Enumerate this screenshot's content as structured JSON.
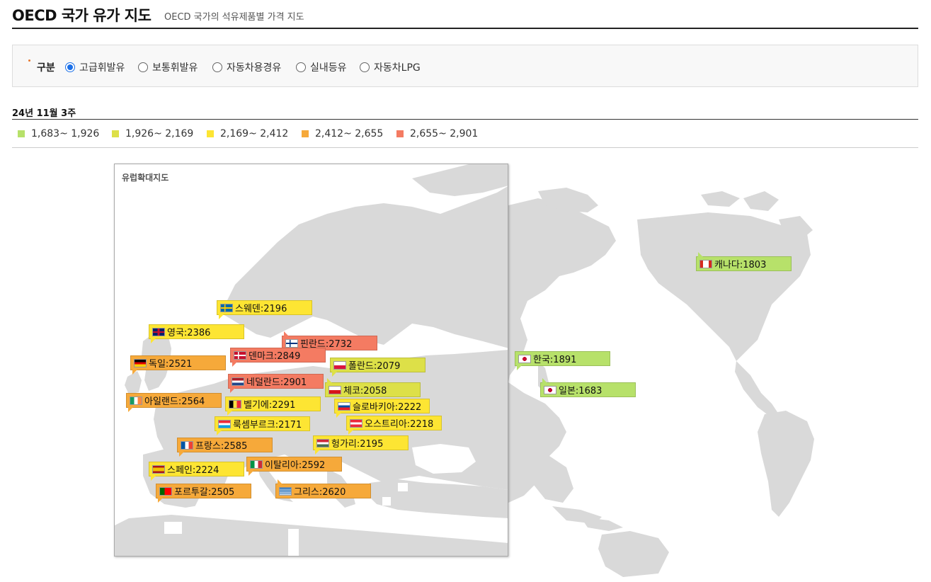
{
  "header": {
    "title": "OECD 국가 유가 지도",
    "subtitle": "OECD 국가의 석유제품별 가격 지도"
  },
  "filter": {
    "label": "구분",
    "options": [
      {
        "label": "고급휘발유",
        "checked": true
      },
      {
        "label": "보통휘발유",
        "checked": false
      },
      {
        "label": "자동차용경유",
        "checked": false
      },
      {
        "label": "실내등유",
        "checked": false
      },
      {
        "label": "자동차LPG",
        "checked": false
      }
    ]
  },
  "week": "24년 11월 3주",
  "legend": [
    {
      "label": "1,683~ 1,926",
      "color": "#b7e16a"
    },
    {
      "label": "1,926~ 2,169",
      "color": "#dde048"
    },
    {
      "label": "2,169~ 2,412",
      "color": "#fde533"
    },
    {
      "label": "2,412~ 2,655",
      "color": "#f6a93a"
    },
    {
      "label": "2,655~ 2,901",
      "color": "#f47b62"
    }
  ],
  "europe_title": "유럽확대지도",
  "countries": [
    {
      "label": "캐나다:1803",
      "flag": "canada",
      "color": "#b7e16a"
    },
    {
      "label": "한국:1891",
      "flag": "korea",
      "color": "#b7e16a"
    },
    {
      "label": "일본:1683",
      "flag": "japan",
      "color": "#b7e16a"
    },
    {
      "label": "스웨덴:2196",
      "flag": "sweden",
      "color": "#fde533"
    },
    {
      "label": "영국:2386",
      "flag": "uk",
      "color": "#fde533"
    },
    {
      "label": "핀란드:2732",
      "flag": "finland",
      "color": "#f47b62"
    },
    {
      "label": "덴마크:2849",
      "flag": "denmark",
      "color": "#f47b62"
    },
    {
      "label": "독일:2521",
      "flag": "germany",
      "color": "#f6a93a"
    },
    {
      "label": "폴란드:2079",
      "flag": "poland",
      "color": "#dde048"
    },
    {
      "label": "네덜란드:2901",
      "flag": "netherlands",
      "color": "#f47b62"
    },
    {
      "label": "체코:2058",
      "flag": "czech",
      "color": "#dde048"
    },
    {
      "label": "아일랜드:2564",
      "flag": "ireland",
      "color": "#f6a93a"
    },
    {
      "label": "벨기에:2291",
      "flag": "belgium",
      "color": "#fde533"
    },
    {
      "label": "슬로바키아:2222",
      "flag": "slovakia",
      "color": "#fde533"
    },
    {
      "label": "룩셈부르크:2171",
      "flag": "luxembourg",
      "color": "#fde533"
    },
    {
      "label": "오스트리아:2218",
      "flag": "austria",
      "color": "#fde533"
    },
    {
      "label": "프랑스:2585",
      "flag": "france",
      "color": "#f6a93a"
    },
    {
      "label": "헝가리:2195",
      "flag": "hungary",
      "color": "#fde533"
    },
    {
      "label": "스페인:2224",
      "flag": "spain",
      "color": "#fde533"
    },
    {
      "label": "이탈리아:2592",
      "flag": "italy",
      "color": "#f6a93a"
    },
    {
      "label": "포르투갈:2505",
      "flag": "portugal",
      "color": "#f6a93a"
    },
    {
      "label": "그리스:2620",
      "flag": "greece",
      "color": "#f6a93a"
    }
  ]
}
